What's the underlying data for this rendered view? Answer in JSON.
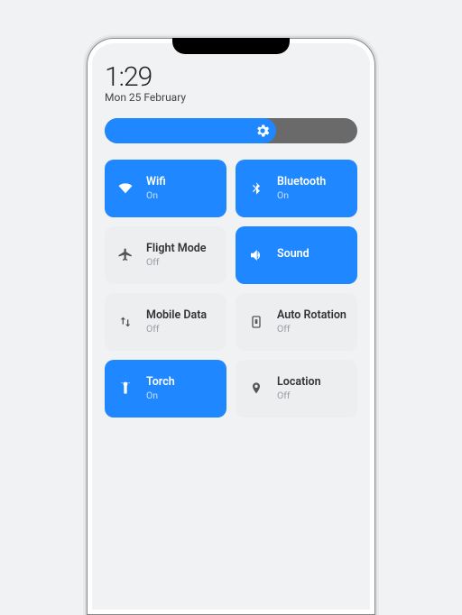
{
  "clock": {
    "time": "1:29",
    "date": "Mon 25 February"
  },
  "brightness": {
    "percent": 68
  },
  "tiles": [
    {
      "id": "wifi",
      "label": "Wifi",
      "status": "On",
      "on": true
    },
    {
      "id": "bluetooth",
      "label": "Bluetooth",
      "status": "On",
      "on": true
    },
    {
      "id": "flight",
      "label": "Flight Mode",
      "status": "Off",
      "on": false
    },
    {
      "id": "sound",
      "label": "Sound",
      "status": "",
      "on": true
    },
    {
      "id": "mobiledata",
      "label": "Mobile Data",
      "status": "Off",
      "on": false
    },
    {
      "id": "autorotate",
      "label": "Auto Rotation",
      "status": "Off",
      "on": false
    },
    {
      "id": "torch",
      "label": "Torch",
      "status": "On",
      "on": true
    },
    {
      "id": "location",
      "label": "Location",
      "status": "Off",
      "on": false
    }
  ],
  "colors": {
    "accent": "#1f87ff",
    "tile_off_bg": "#eceef0"
  }
}
